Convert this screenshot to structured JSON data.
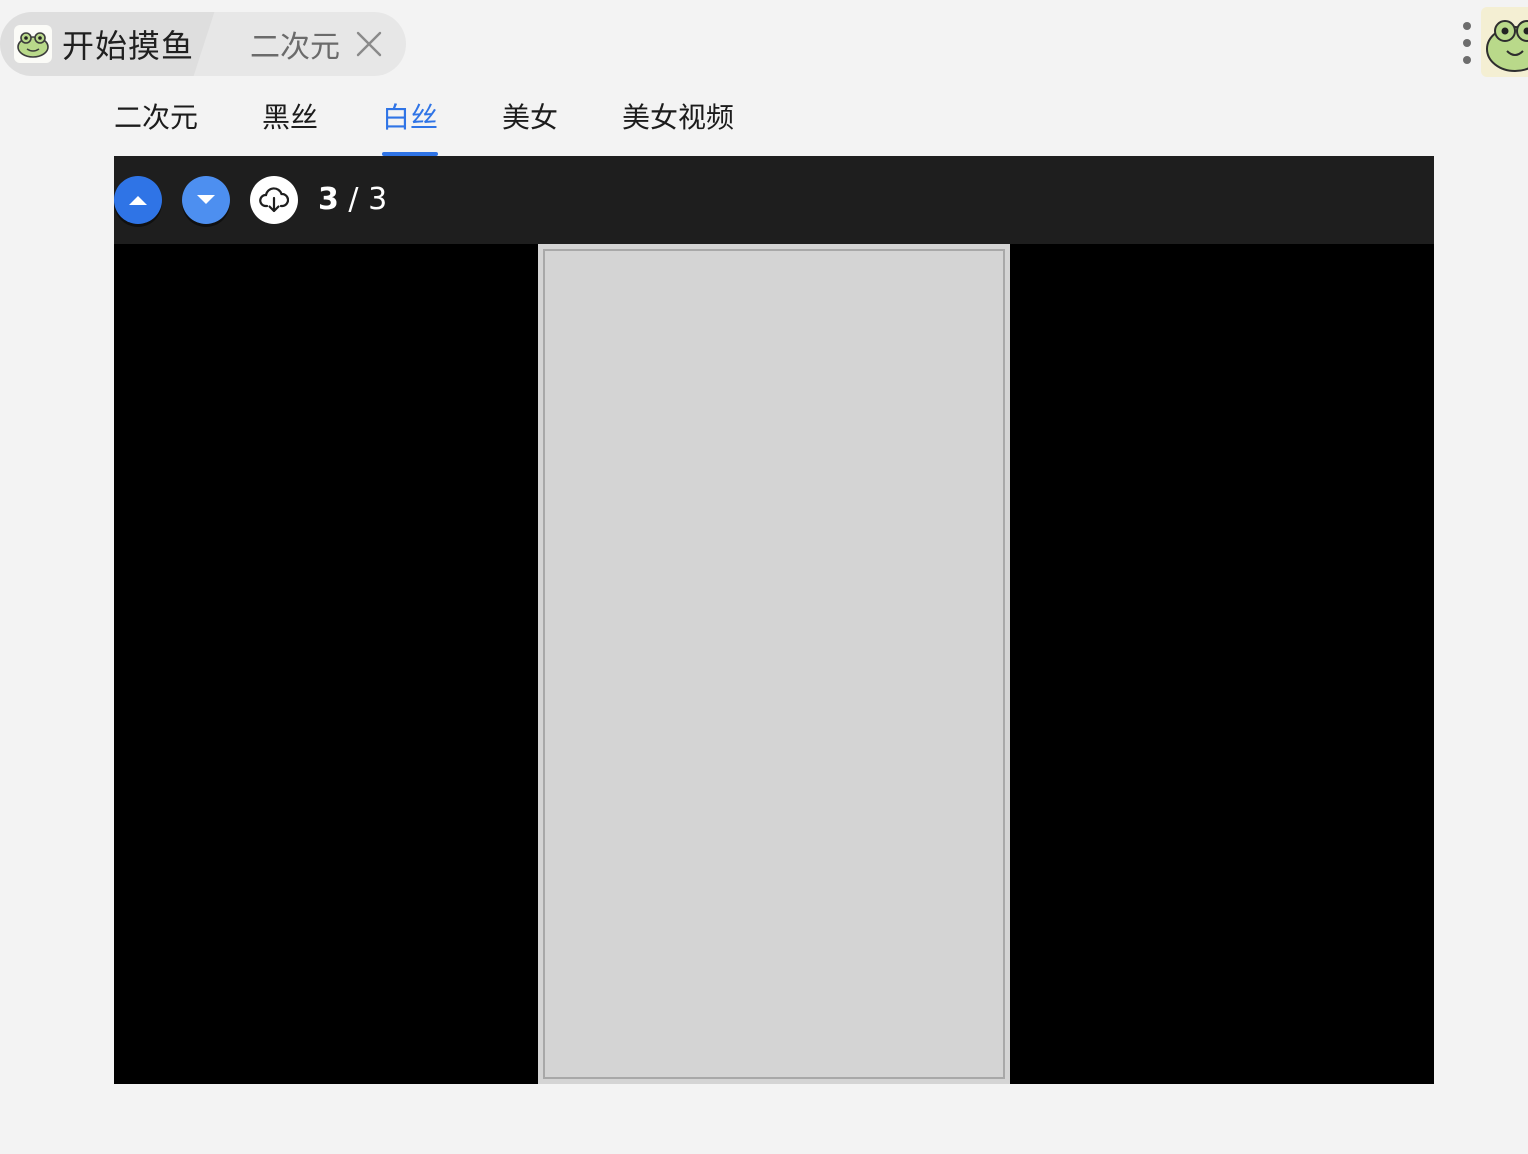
{
  "tabs": {
    "home_title": "开始摸鱼",
    "current_label": "二次元"
  },
  "categories": [
    {
      "label": "二次元",
      "active": false
    },
    {
      "label": "黑丝",
      "active": false
    },
    {
      "label": "白丝",
      "active": true
    },
    {
      "label": "美女",
      "active": false
    },
    {
      "label": "美女视频",
      "active": false
    }
  ],
  "viewer": {
    "current_index": "3",
    "separator": "/",
    "total": "3"
  },
  "icons": {
    "frog": "frog-icon",
    "close": "close-icon",
    "more": "more-vertical-icon",
    "prev": "chevron-up-icon",
    "next": "chevron-down-icon",
    "download": "cloud-download-icon"
  },
  "colors": {
    "accent": "#2f74e6",
    "page_bg": "#f3f3f3",
    "toolbar_bg": "#1e1e1e",
    "viewer_bg": "#000000"
  }
}
